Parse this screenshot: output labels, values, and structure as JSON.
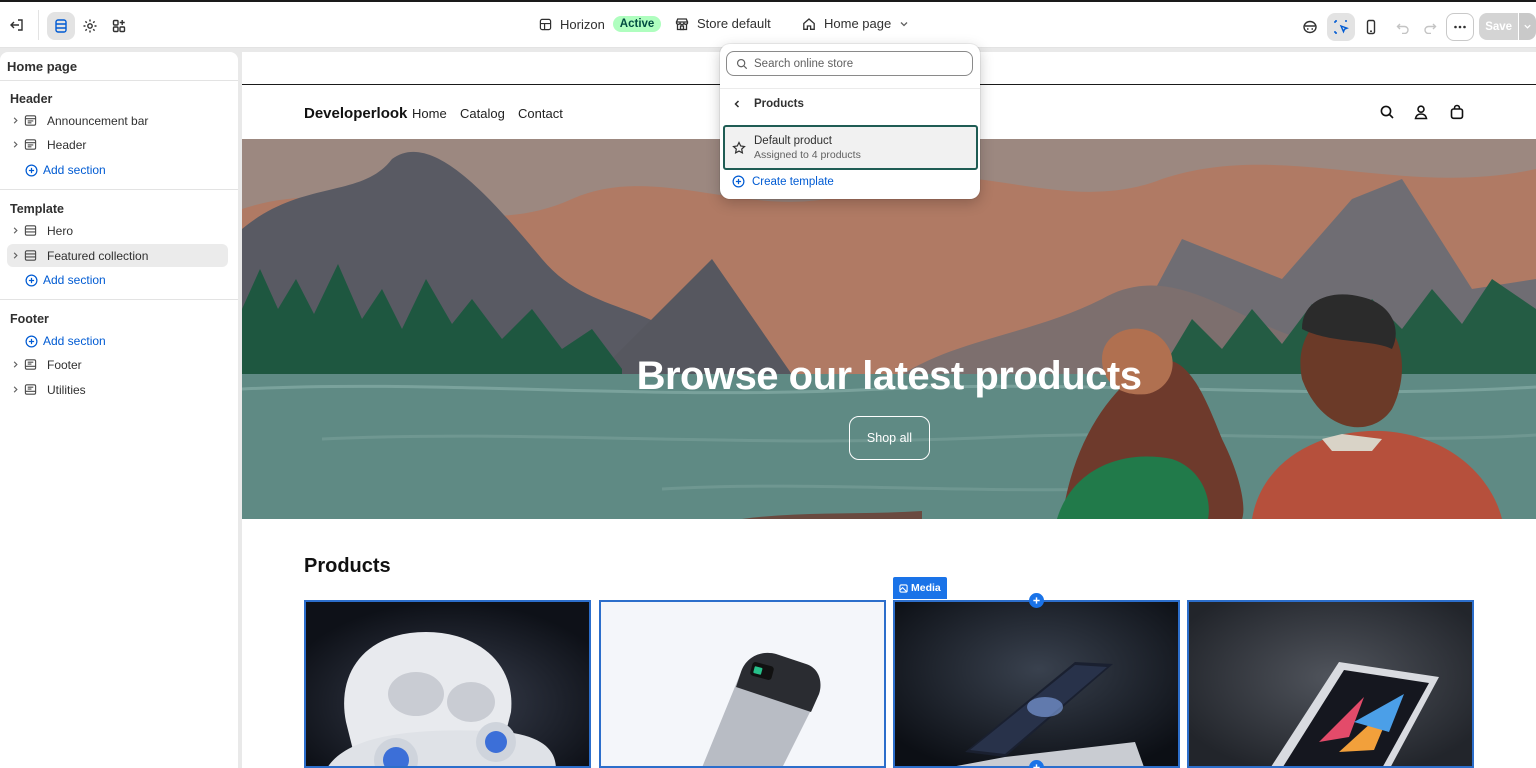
{
  "topbar": {
    "theme_name": "Horizon",
    "theme_status": "Active",
    "store_label": "Store default",
    "page_selector": "Home page",
    "save_label": "Save"
  },
  "sidebar": {
    "title": "Home page",
    "groups": [
      {
        "heading": "Header",
        "items": [
          "Announcement bar",
          "Header"
        ],
        "add_label": "Add section"
      },
      {
        "heading": "Template",
        "items": [
          "Hero",
          "Featured collection"
        ],
        "add_label": "Add section"
      },
      {
        "heading": "Footer",
        "items": [
          "Footer",
          "Utilities"
        ],
        "add_label": "Add section"
      }
    ],
    "selected_item": "Featured collection"
  },
  "storefront": {
    "brand": "Developerlook",
    "nav": [
      "Home",
      "Catalog",
      "Contact"
    ],
    "hero_title": "Browse our latest products",
    "hero_button": "Shop all",
    "products_title": "Products",
    "media_tag": "Media",
    "products": [
      {
        "image": "wireless-earbuds-case"
      },
      {
        "image": "portable-power-bank"
      },
      {
        "image": "laptop"
      },
      {
        "image": "tablet"
      }
    ]
  },
  "popover": {
    "search_placeholder": "Search online store",
    "back_label": "Products",
    "template_name": "Default product",
    "template_meta": "Assigned to 4 products",
    "create_label": "Create template"
  },
  "colors": {
    "accent_blue": "#005bd3",
    "selection_blue": "#2c6ecb",
    "active_badge_bg": "#affebf",
    "active_badge_text": "#014b40",
    "popover_selected_border": "#1f5c54"
  }
}
